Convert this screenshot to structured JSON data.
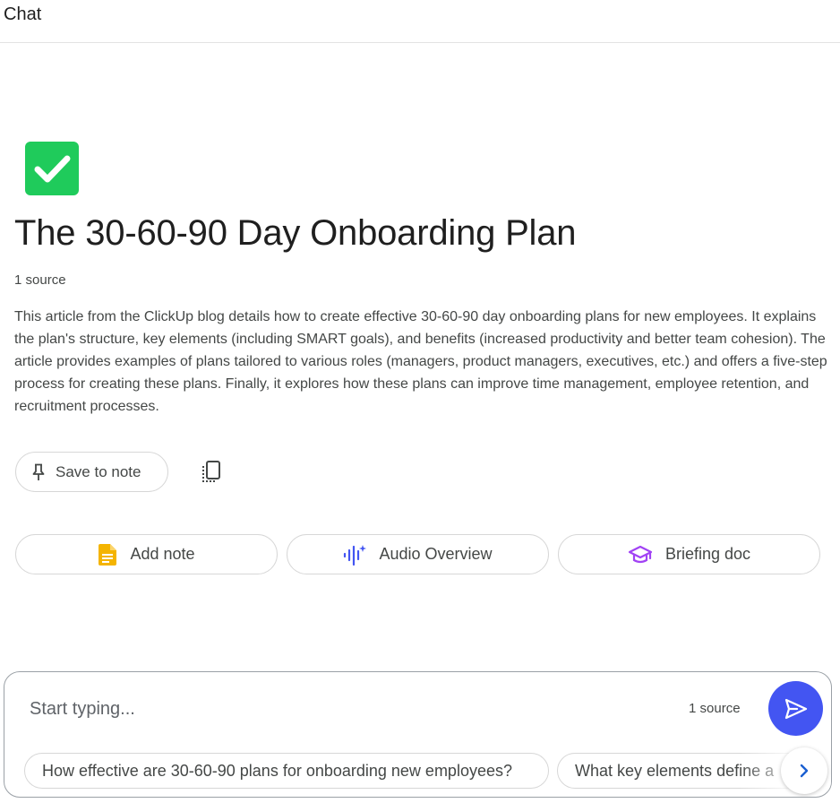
{
  "header": {
    "title": "Chat"
  },
  "notebook": {
    "emoji_icon": "white-check-mark-icon",
    "emoji_color": "#1fcb5b",
    "title": "The 30-60-90 Day Onboarding Plan",
    "source_count": "1 source",
    "summary": "This article from the ClickUp blog details how to create effective 30-60-90 day onboarding plans for new employees. It explains the plan's structure, key elements (including SMART goals), and benefits (increased productivity and better team cohesion). The article provides examples of plans tailored to various roles (managers, product managers, executives, etc.) and offers a five-step process for creating these plans. Finally, it explores how these plans can improve time management, employee retention, and recruitment processes."
  },
  "summary_actions": {
    "save_label": "Save to note",
    "save_icon": "pin-icon",
    "copy_icon": "copy-icon"
  },
  "action_chips": [
    {
      "label": "Add note",
      "icon": "note-icon",
      "color": "#f4b400"
    },
    {
      "label": "Audio Overview",
      "icon": "audio-wave-icon",
      "color": "#4355f2"
    },
    {
      "label": "Briefing doc",
      "icon": "graduation-cap-icon",
      "color": "#a142f4"
    }
  ],
  "composer": {
    "placeholder": "Start typing...",
    "value": "",
    "source_count": "1 source",
    "send_icon": "send-icon",
    "accent": "#4355f2",
    "suggestions": [
      "How effective are 30-60-90 plans for onboarding new employees?",
      "What key elements define a"
    ],
    "next_icon": "chevron-right-icon"
  }
}
